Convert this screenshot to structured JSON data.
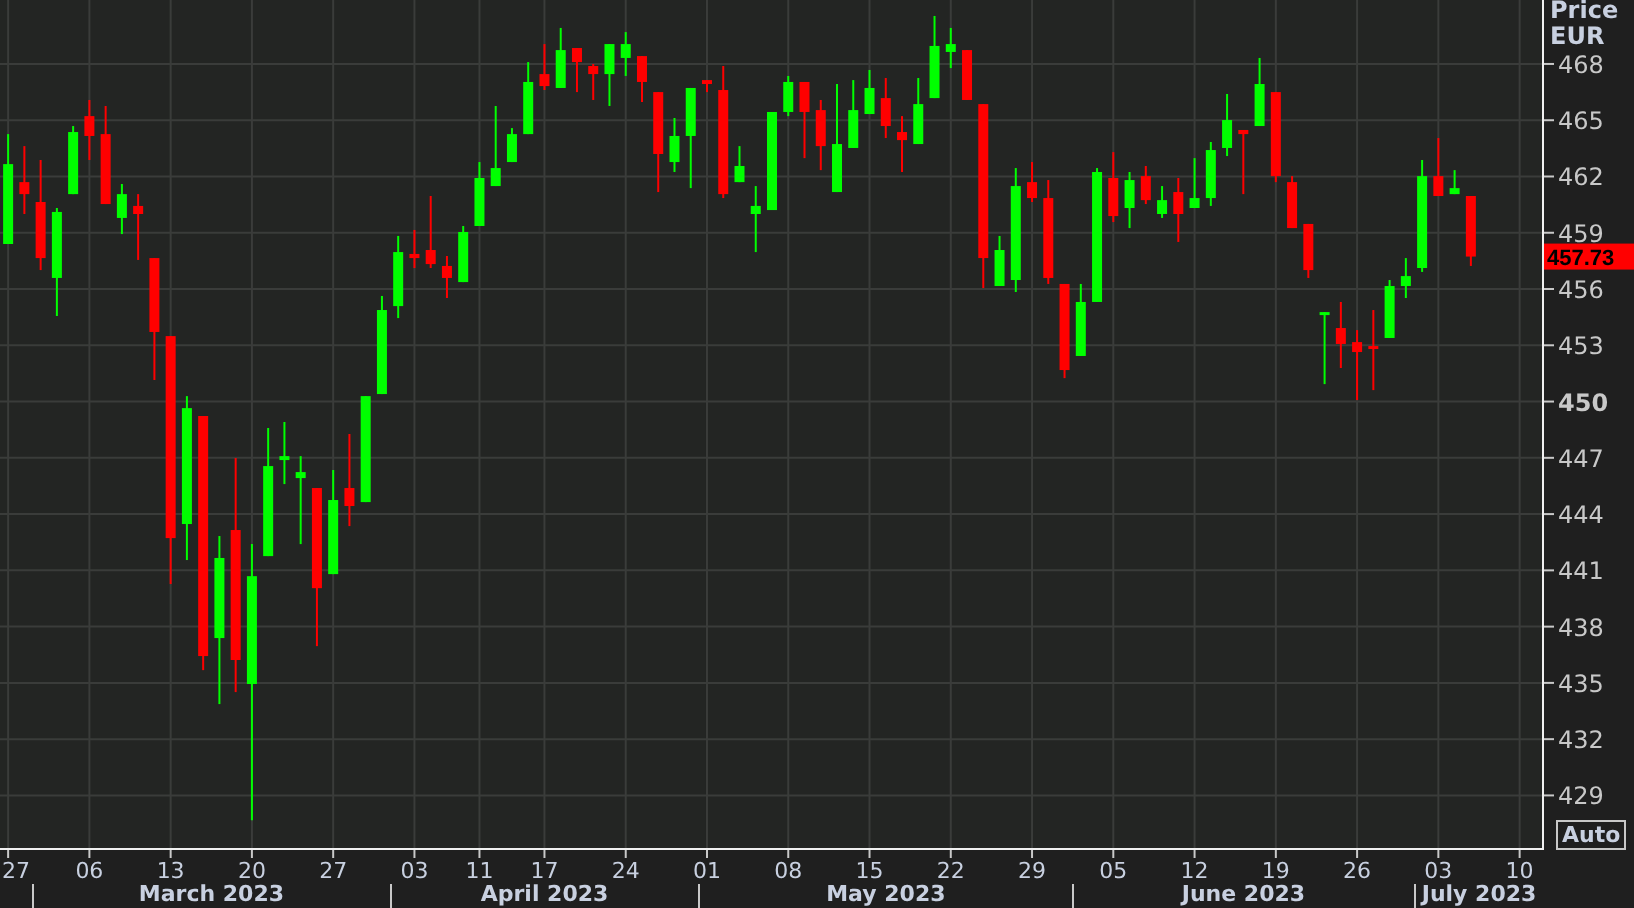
{
  "chart": {
    "auto_button": {
      "label": "Auto"
    },
    "chart_data": {
      "type": "candlestick",
      "ylabel": "Price EUR",
      "ylim": [
        426.09,
        471.41
      ],
      "grid": true,
      "yticks": [
        468,
        465,
        462,
        459,
        456,
        453,
        450,
        447,
        444,
        441,
        438,
        435,
        432,
        429
      ],
      "categories": [
        "27",
        null,
        null,
        null,
        null,
        "06",
        null,
        null,
        null,
        null,
        "13",
        null,
        null,
        null,
        null,
        "20",
        null,
        null,
        null,
        null,
        "27",
        null,
        null,
        null,
        null,
        "03",
        null,
        null,
        null,
        "11",
        null,
        null,
        null,
        "17",
        null,
        null,
        null,
        null,
        "24",
        null,
        null,
        null,
        null,
        "01",
        null,
        null,
        null,
        null,
        "08",
        null,
        null,
        null,
        null,
        "15",
        null,
        null,
        null,
        null,
        "22",
        null,
        null,
        null,
        null,
        "29",
        null,
        null,
        null,
        null,
        "05",
        null,
        null,
        null,
        null,
        "12",
        null,
        null,
        null,
        null,
        "19",
        null,
        null,
        null,
        null,
        "26",
        null,
        null,
        null,
        null,
        "03",
        null,
        null,
        null,
        null,
        "10",
        null
      ],
      "ohlc": [
        [
          458.4,
          464.26,
          458.4,
          462.66
        ],
        [
          461.7,
          463.62,
          460.0,
          461.06
        ],
        [
          460.64,
          462.88,
          457.01,
          457.65
        ],
        [
          456.59,
          460.32,
          454.56,
          460.11
        ],
        [
          461.06,
          464.69,
          461.06,
          464.37
        ],
        [
          465.22,
          466.08,
          462.88,
          464.16
        ],
        [
          464.26,
          465.76,
          460.53,
          460.53
        ],
        [
          459.79,
          461.6,
          458.93,
          461.06
        ],
        [
          460.43,
          461.06,
          457.55,
          460.0
        ],
        [
          457.65,
          457.65,
          451.15,
          453.71
        ],
        [
          453.49,
          453.49,
          440.27,
          442.72
        ],
        [
          443.47,
          450.29,
          441.55,
          449.65
        ],
        [
          449.23,
          449.23,
          435.68,
          436.43
        ],
        [
          437.39,
          442.83,
          433.87,
          441.66
        ],
        [
          443.15,
          446.99,
          434.51,
          436.22
        ],
        [
          434.94,
          442.4,
          427.68,
          440.69
        ],
        [
          441.76,
          448.59,
          441.76,
          446.56
        ],
        [
          446.88,
          448.91,
          445.6,
          447.09
        ],
        [
          445.92,
          447.09,
          442.4,
          446.24
        ],
        [
          445.39,
          445.39,
          436.96,
          440.05
        ],
        [
          440.8,
          446.35,
          440.8,
          444.75
        ],
        [
          445.39,
          448.27,
          443.36,
          444.43
        ],
        [
          444.64,
          450.29,
          444.64,
          450.29
        ],
        [
          450.4,
          455.63,
          450.4,
          454.88
        ],
        [
          455.09,
          458.83,
          454.45,
          457.97
        ],
        [
          457.87,
          459.15,
          457.12,
          457.65
        ],
        [
          458.08,
          460.96,
          457.12,
          457.33
        ],
        [
          457.23,
          457.76,
          455.52,
          456.59
        ],
        [
          456.37,
          459.36,
          456.37,
          459.04
        ],
        [
          459.36,
          462.77,
          459.36,
          461.92
        ],
        [
          461.49,
          465.76,
          461.49,
          462.45
        ],
        [
          462.77,
          464.58,
          462.77,
          464.26
        ],
        [
          464.26,
          468.1,
          464.26,
          467.04
        ],
        [
          467.46,
          469.06,
          466.61,
          466.82
        ],
        [
          466.72,
          469.92,
          466.72,
          468.74
        ],
        [
          468.85,
          468.85,
          466.5,
          468.1
        ],
        [
          467.89,
          468.0,
          466.08,
          467.46
        ],
        [
          467.46,
          469.06,
          465.76,
          469.06
        ],
        [
          468.32,
          469.7,
          467.36,
          469.06
        ],
        [
          468.42,
          468.42,
          465.97,
          467.04
        ],
        [
          466.5,
          466.5,
          461.17,
          463.2
        ],
        [
          462.77,
          465.12,
          462.24,
          464.16
        ],
        [
          464.16,
          466.72,
          461.38,
          466.72
        ],
        [
          467.14,
          467.14,
          466.5,
          466.93
        ],
        [
          466.61,
          467.89,
          460.85,
          461.06
        ],
        [
          461.7,
          463.62,
          461.7,
          462.56
        ],
        [
          460.0,
          461.49,
          457.97,
          460.43
        ],
        [
          460.21,
          465.44,
          460.21,
          465.44
        ],
        [
          465.44,
          467.36,
          465.22,
          467.04
        ],
        [
          467.04,
          467.04,
          462.98,
          465.44
        ],
        [
          465.54,
          466.08,
          462.34,
          463.62
        ],
        [
          461.17,
          466.93,
          461.17,
          463.73
        ],
        [
          463.52,
          467.14,
          463.52,
          465.54
        ],
        [
          465.33,
          467.68,
          465.33,
          466.72
        ],
        [
          466.18,
          467.25,
          464.05,
          464.69
        ],
        [
          464.37,
          465.22,
          462.24,
          463.94
        ],
        [
          463.73,
          467.25,
          463.73,
          465.86
        ],
        [
          466.18,
          470.56,
          466.18,
          468.96
        ],
        [
          468.64,
          469.92,
          467.78,
          469.06
        ],
        [
          468.74,
          468.74,
          466.08,
          466.08
        ],
        [
          465.86,
          465.86,
          456.05,
          457.65
        ],
        [
          456.16,
          458.83,
          456.16,
          458.08
        ],
        [
          456.48,
          462.45,
          455.84,
          461.49
        ],
        [
          461.7,
          462.77,
          460.64,
          460.85
        ],
        [
          460.85,
          461.81,
          456.27,
          456.59
        ],
        [
          456.27,
          456.27,
          451.25,
          451.68
        ],
        [
          452.43,
          456.27,
          452.43,
          455.31
        ],
        [
          455.31,
          462.45,
          455.31,
          462.24
        ],
        [
          461.92,
          463.3,
          459.57,
          459.89
        ],
        [
          460.32,
          462.24,
          459.25,
          461.81
        ],
        [
          462.02,
          462.56,
          460.53,
          460.74
        ],
        [
          460.0,
          461.49,
          459.79,
          460.74
        ],
        [
          461.17,
          461.92,
          458.51,
          460.0
        ],
        [
          460.32,
          462.98,
          460.32,
          460.85
        ],
        [
          460.85,
          463.84,
          460.43,
          463.41
        ],
        [
          463.52,
          466.4,
          463.09,
          465.01
        ],
        [
          464.48,
          464.48,
          461.06,
          464.26
        ],
        [
          464.69,
          468.32,
          464.69,
          466.93
        ],
        [
          466.5,
          466.5,
          461.7,
          462.02
        ],
        [
          461.7,
          462.02,
          459.25,
          459.25
        ],
        [
          459.47,
          459.47,
          456.59,
          457.01
        ],
        [
          454.67,
          454.77,
          450.93,
          454.77
        ],
        [
          453.92,
          455.31,
          451.79,
          453.07
        ],
        [
          453.17,
          453.81,
          450.08,
          452.64
        ],
        [
          452.96,
          454.88,
          450.61,
          452.85
        ],
        [
          453.39,
          456.48,
          453.39,
          456.16
        ],
        [
          456.16,
          457.65,
          455.52,
          456.69
        ],
        [
          457.12,
          462.88,
          456.91,
          462.02
        ],
        [
          462.02,
          464.05,
          460.96,
          460.96
        ],
        [
          461.06,
          462.34,
          461.06,
          461.38
        ],
        [
          460.96,
          460.96,
          457.23,
          457.73
        ],
        null,
        null,
        null,
        null
      ],
      "annotations": [
        "March 2023",
        "April 2023",
        "May 2023",
        "June 2023",
        "July 2023"
      ]
    },
    "last_price_label": "457.73"
  }
}
